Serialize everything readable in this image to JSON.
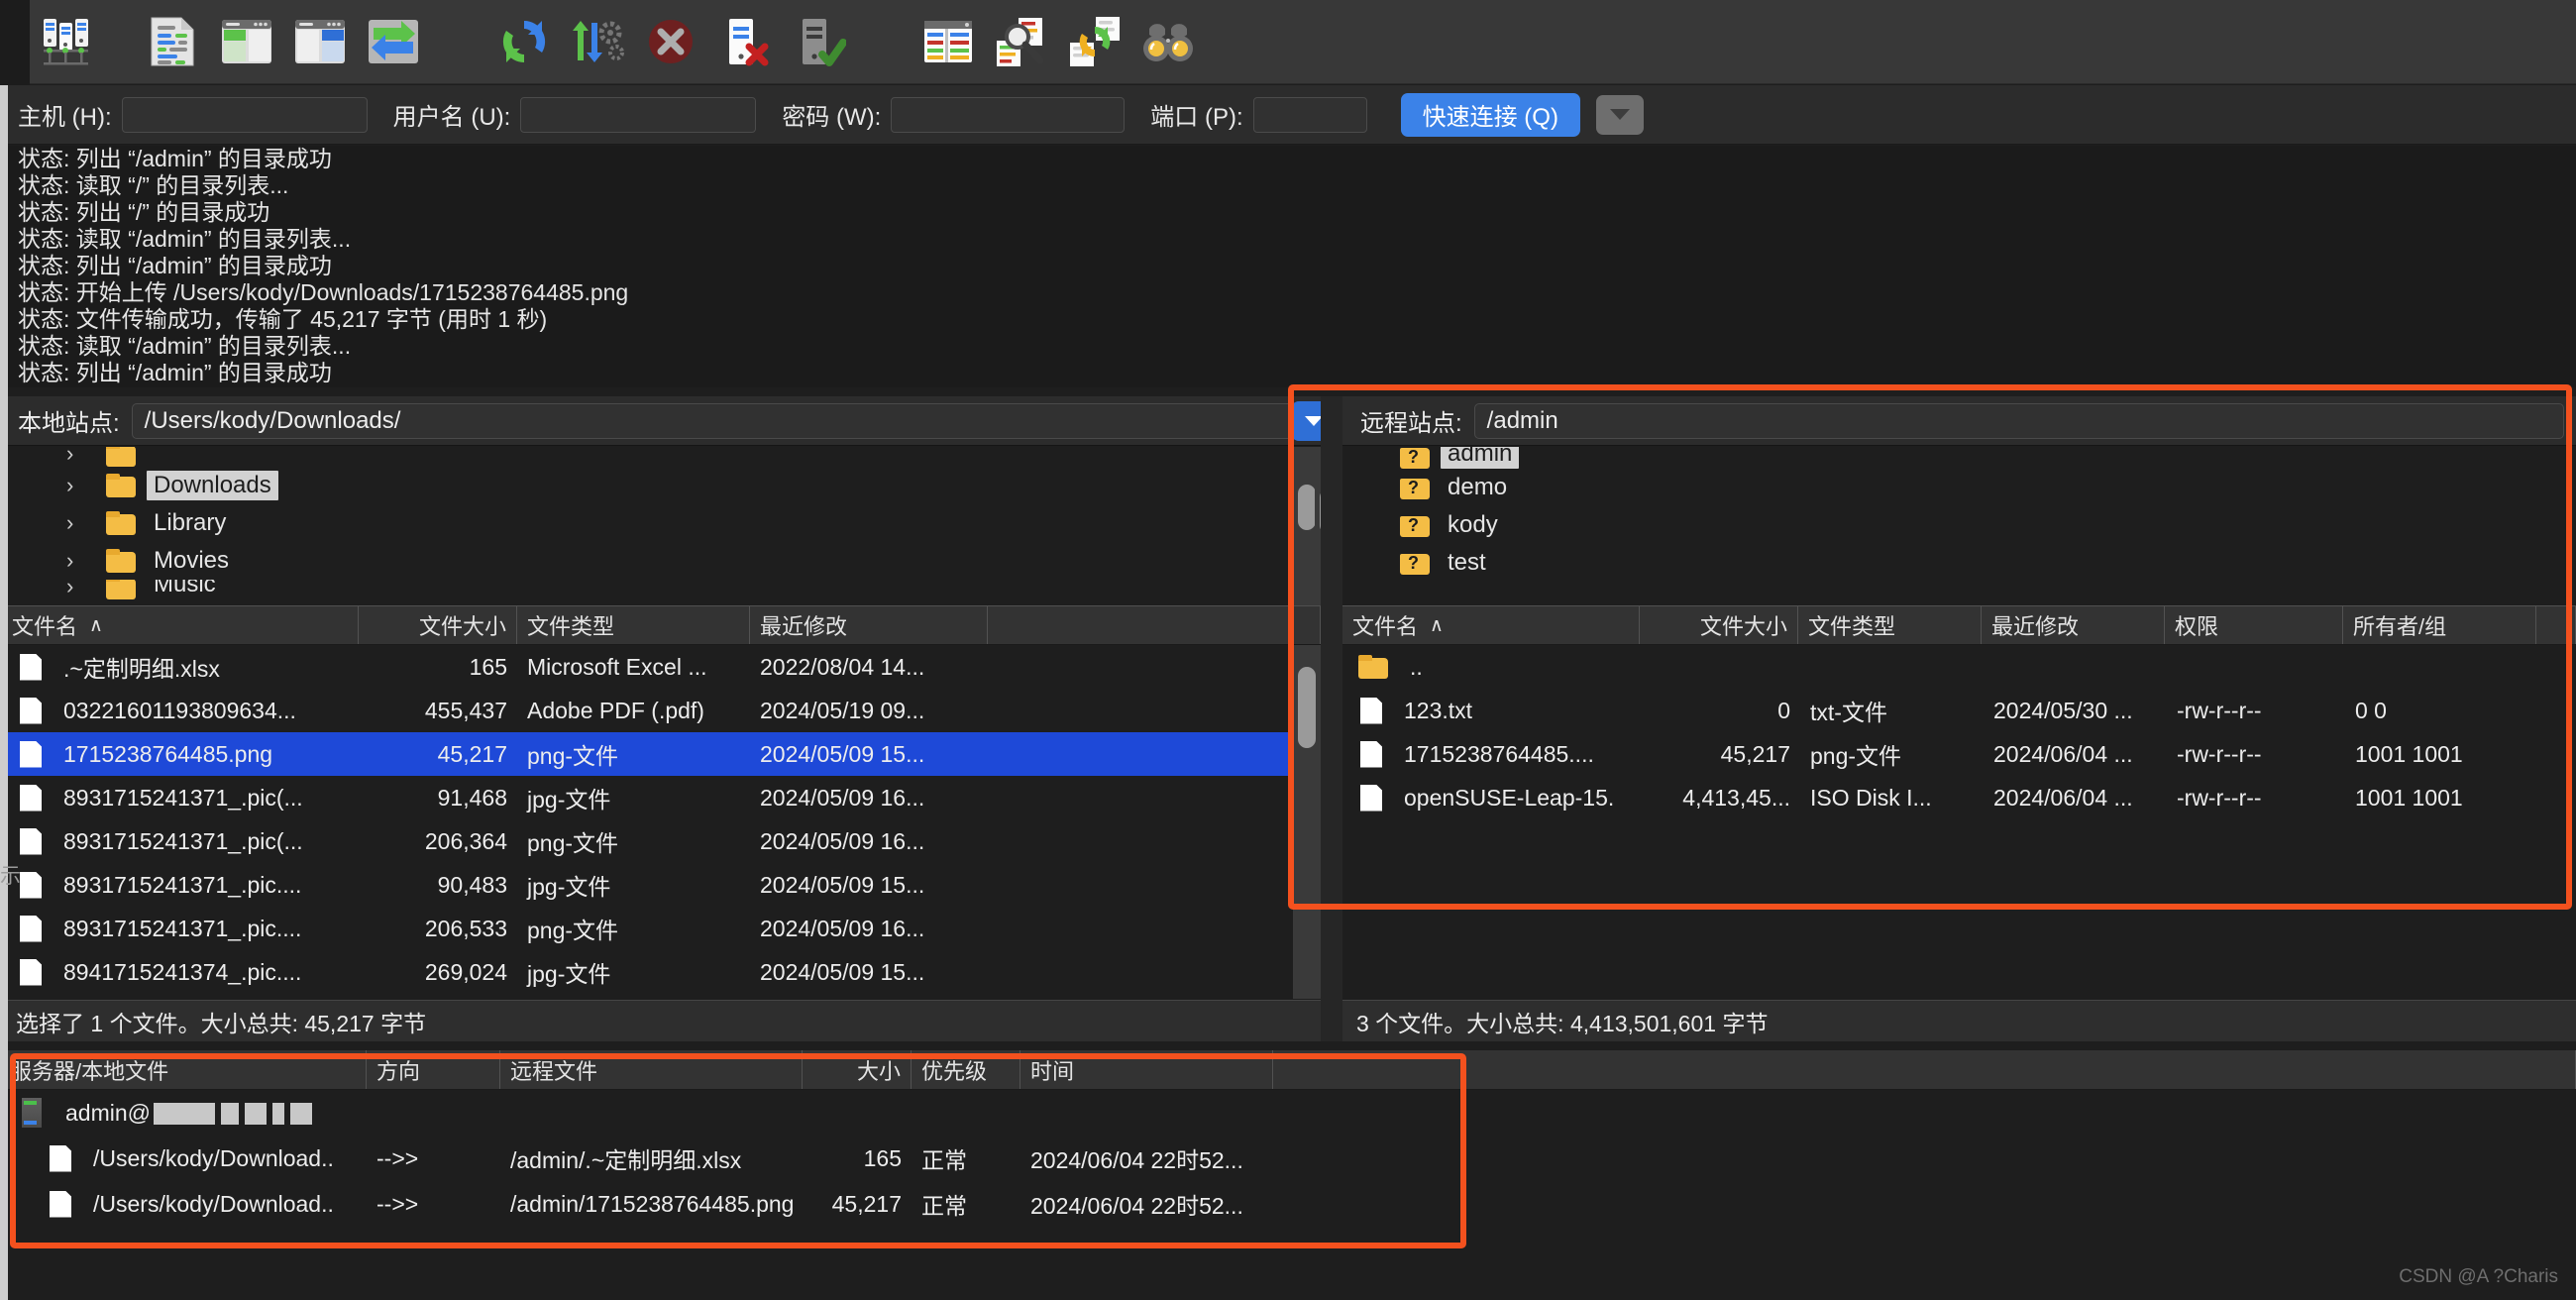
{
  "toolbar": {
    "icons": [
      {
        "name": "site-manager-icon",
        "title": "站点管理器"
      },
      {
        "name": "toggle-message-log-icon",
        "title": "切换消息日志显示"
      },
      {
        "name": "toggle-local-tree-icon",
        "title": "切换本地目录树显示"
      },
      {
        "name": "toggle-remote-tree-icon",
        "title": "切换远程目录树显示"
      },
      {
        "name": "toggle-transfer-queue-icon",
        "title": "切换传输队列显示"
      },
      {
        "name": "refresh-icon",
        "title": "刷新文件和文件夹列表"
      },
      {
        "name": "process-queue-icon",
        "title": "处理队列"
      },
      {
        "name": "cancel-operation-icon",
        "title": "取消当前操作"
      },
      {
        "name": "disconnect-icon",
        "title": "断开当前所见服务器的连接"
      },
      {
        "name": "reconnect-icon",
        "title": "重新连接到上次使用的服务器"
      },
      {
        "name": "filter-icon",
        "title": "目录列表过滤器"
      },
      {
        "name": "compare-directories-icon",
        "title": "比较目录列表"
      },
      {
        "name": "synchronized-browsing-icon",
        "title": "切换同步浏览"
      },
      {
        "name": "find-files-icon",
        "title": "搜索服务器上的远程文件"
      }
    ]
  },
  "quickconnect": {
    "host_label": "主机 (H):",
    "host_value": "",
    "user_label": "用户名 (U):",
    "user_value": "",
    "pass_label": "密码 (W):",
    "pass_value": "",
    "port_label": "端口 (P):",
    "port_value": "",
    "connect_label": "快速连接 (Q)",
    "history_icon": "chevron-down-icon"
  },
  "log": {
    "lines": [
      "状态: 列出 “/admin” 的目录成功",
      "状态: 读取 “/” 的目录列表...",
      "状态: 列出 “/” 的目录成功",
      "状态: 读取 “/admin” 的目录列表...",
      "状态: 列出 “/admin” 的目录成功",
      "状态: 开始上传 /Users/kody/Downloads/1715238764485.png",
      "状态: 文件传输成功，传输了 45,217 字节 (用时 1 秒)",
      "状态: 读取 “/admin” 的目录列表...",
      "状态: 列出 “/admin” 的目录成功"
    ]
  },
  "local": {
    "site_label": "本地站点:",
    "path": "/Users/kody/Downloads/",
    "tree": [
      {
        "label": "",
        "selected": false,
        "partial": true
      },
      {
        "label": "Downloads",
        "selected": true,
        "partial": false
      },
      {
        "label": "Library",
        "selected": false,
        "partial": false
      },
      {
        "label": "Movies",
        "selected": false,
        "partial": false
      },
      {
        "label": "Music",
        "selected": false,
        "partial": true
      }
    ],
    "columns": [
      "文件名",
      "文件大小",
      "文件类型",
      "最近修改"
    ],
    "sort_indicator": "∧",
    "rows": [
      {
        "name": ".~定制明细.xlsx",
        "size": "165",
        "type": "Microsoft Excel ...",
        "modified": "2022/08/04 14...",
        "selected": false
      },
      {
        "name": "03221601193809634...",
        "size": "455,437",
        "type": "Adobe PDF (.pdf)",
        "modified": "2024/05/19 09...",
        "selected": false
      },
      {
        "name": "1715238764485.png",
        "size": "45,217",
        "type": "png-文件",
        "modified": "2024/05/09 15...",
        "selected": true
      },
      {
        "name": "8931715241371_.pic(...",
        "size": "91,468",
        "type": "jpg-文件",
        "modified": "2024/05/09 16...",
        "selected": false
      },
      {
        "name": "8931715241371_.pic(...",
        "size": "206,364",
        "type": "png-文件",
        "modified": "2024/05/09 16...",
        "selected": false
      },
      {
        "name": "8931715241371_.pic....",
        "size": "90,483",
        "type": "jpg-文件",
        "modified": "2024/05/09 15...",
        "selected": false
      },
      {
        "name": "8931715241371_.pic....",
        "size": "206,533",
        "type": "png-文件",
        "modified": "2024/05/09 16...",
        "selected": false
      },
      {
        "name": "8941715241374_.pic....",
        "size": "269,024",
        "type": "jpg-文件",
        "modified": "2024/05/09 15...",
        "selected": false
      }
    ],
    "status": "选择了 1 个文件。大小总共: 45,217 字节"
  },
  "remote": {
    "site_label": "远程站点:",
    "path": "/admin",
    "tree": [
      {
        "label": "admin",
        "selected": true,
        "partial": true
      },
      {
        "label": "demo",
        "selected": false,
        "partial": false
      },
      {
        "label": "kody",
        "selected": false,
        "partial": false
      },
      {
        "label": "test",
        "selected": false,
        "partial": false
      }
    ],
    "columns": [
      "文件名",
      "文件大小",
      "文件类型",
      "最近修改",
      "权限",
      "所有者/组"
    ],
    "sort_indicator": "∧",
    "rows": [
      {
        "name": "..",
        "size": "",
        "type": "",
        "modified": "",
        "perms": "",
        "owner": "",
        "is_dir": true
      },
      {
        "name": "123.txt",
        "size": "0",
        "type": "txt-文件",
        "modified": "2024/05/30 ...",
        "perms": "-rw-r--r--",
        "owner": "0 0",
        "is_dir": false
      },
      {
        "name": "1715238764485....",
        "size": "45,217",
        "type": "png-文件",
        "modified": "2024/06/04 ...",
        "perms": "-rw-r--r--",
        "owner": "1001 1001",
        "is_dir": false
      },
      {
        "name": "openSUSE-Leap-15.",
        "size": "4,413,45...",
        "type": "ISO Disk I...",
        "modified": "2024/06/04 ...",
        "perms": "-rw-r--r--",
        "owner": "1001 1001",
        "is_dir": false
      }
    ],
    "status": "3 个文件。大小总共: 4,413,501,601 字节"
  },
  "queue": {
    "columns": [
      "服务器/本地文件",
      "方向",
      "远程文件",
      "大小",
      "优先级",
      "时间"
    ],
    "server_row": {
      "label": "admin@",
      "redacted": true
    },
    "rows": [
      {
        "local": "/Users/kody/Download..",
        "dir": "-->>",
        "remote": "/admin/.~定制明细.xlsx",
        "size": "165",
        "priority": "正常",
        "time": "2024/06/04 22时52..."
      },
      {
        "local": "/Users/kody/Download..",
        "dir": "-->>",
        "remote": "/admin/1715238764485.png",
        "size": "45,217",
        "priority": "正常",
        "time": "2024/06/04 22时52..."
      }
    ]
  },
  "watermark": "CSDN @A ?Charis",
  "colors": {
    "accent_blue": "#3b82e8",
    "selection_blue": "#1e49d8",
    "annotation_red": "#f4511e",
    "folder_yellow": "#f4bd45",
    "window_bg": "#1e1e1e",
    "toolbar_bg": "#383838"
  }
}
